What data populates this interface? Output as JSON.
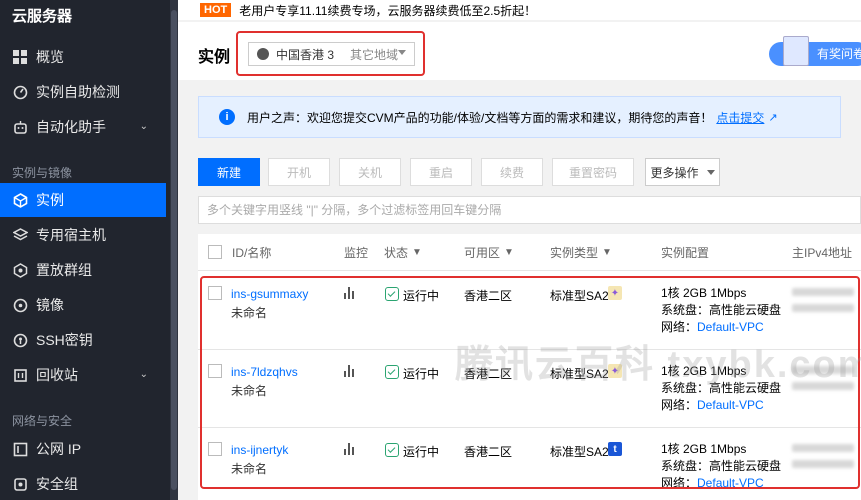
{
  "sidebar": {
    "title": "云服务器",
    "items": [
      {
        "label": "概览",
        "icon": "grid-icon"
      },
      {
        "label": "实例自助检测",
        "icon": "gauge-icon"
      },
      {
        "label": "自动化助手",
        "icon": "robot-icon",
        "expandable": true
      },
      {
        "label": "实例",
        "icon": "cube-icon",
        "active": true
      },
      {
        "label": "专用宿主机",
        "icon": "layers-icon"
      },
      {
        "label": "置放群组",
        "icon": "hexagon-icon"
      },
      {
        "label": "镜像",
        "icon": "disc-icon"
      },
      {
        "label": "SSH密钥",
        "icon": "key-icon"
      },
      {
        "label": "回收站",
        "icon": "recycle-icon",
        "expandable": true
      },
      {
        "label": "公网 IP",
        "icon": "ip-icon"
      },
      {
        "label": "安全组",
        "icon": "shield-icon"
      }
    ],
    "sections": [
      "实例与镜像",
      "网络与安全"
    ]
  },
  "banner": {
    "hot": "HOT",
    "text": "老用户专享11.11续费专场，云服务器续费低至2.5折起！"
  },
  "header": {
    "title": "实例",
    "region": "中国香港 3",
    "other_regions": "其它地域",
    "feedback": "有奖问卷"
  },
  "notice": {
    "text": "用户之声：欢迎您提交CVM产品的功能/体验/文档等方面的需求和建议，期待您的声音！",
    "link": "点击提交"
  },
  "toolbar": {
    "new": "新建",
    "start": "开机",
    "stop": "关机",
    "restart": "重启",
    "renew": "续费",
    "reset_password": "重置密码",
    "more": "更多操作"
  },
  "search": {
    "placeholder": "多个关键字用竖线 \"|\" 分隔，多个过滤标签用回车键分隔"
  },
  "table": {
    "headers": {
      "id_name": "ID/名称",
      "monitor": "监控",
      "status": "状态",
      "zone": "可用区",
      "type": "实例类型",
      "config": "实例配置",
      "ip": "主IPv4地址"
    },
    "rows": [
      {
        "id": "ins-gsummaxy",
        "name": "未命名",
        "status": "运行中",
        "zone": "香港二区",
        "type": "标准型SA2",
        "badge": "star",
        "spec": "1核 2GB 1Mbps",
        "disk": "系统盘：高性能云硬盘",
        "network_label": "网络：",
        "network": "Default-VPC"
      },
      {
        "id": "ins-7ldzqhvs",
        "name": "未命名",
        "status": "运行中",
        "zone": "香港二区",
        "type": "标准型SA2",
        "badge": "star",
        "spec": "1核 2GB 1Mbps",
        "disk": "系统盘：高性能云硬盘",
        "network_label": "网络：",
        "network": "Default-VPC"
      },
      {
        "id": "ins-ijnertyk",
        "name": "未命名",
        "status": "运行中",
        "zone": "香港二区",
        "type": "标准型SA2",
        "badge": "t",
        "spec": "1核 2GB 1Mbps",
        "disk": "系统盘：高性能云硬盘",
        "network_label": "网络：",
        "network": "Default-VPC"
      }
    ]
  },
  "watermark": "腾讯云百科 txybk.com",
  "colors": {
    "accent": "#006eff",
    "sidebar_bg": "#21252e",
    "highlight": "#e0302e",
    "running": "#2ba471"
  }
}
